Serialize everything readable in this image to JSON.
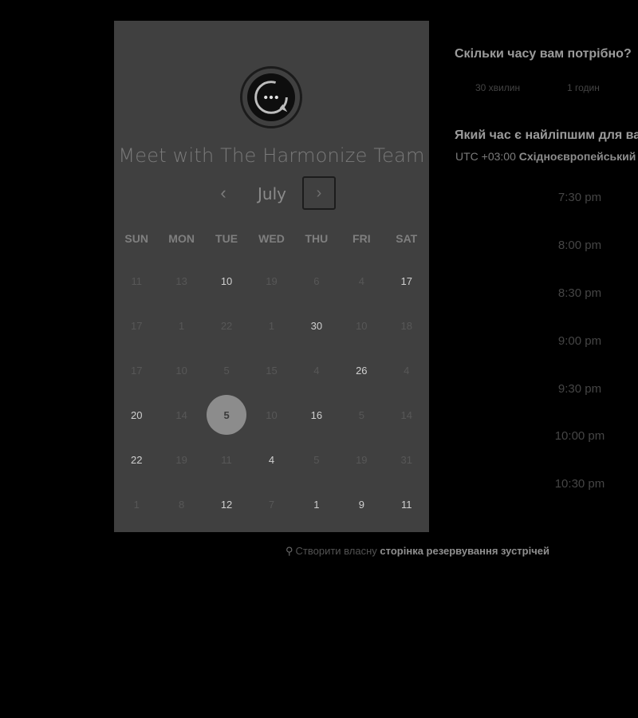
{
  "calendar": {
    "title": "Meet with The Harmonize Team",
    "month": "July",
    "prev_icon": "‹",
    "next_icon": "›",
    "weekdays": [
      "SUN",
      "MON",
      "TUE",
      "WED",
      "THU",
      "FRI",
      "SAT"
    ],
    "weeks": [
      [
        {
          "d": "11",
          "a": false
        },
        {
          "d": "13",
          "a": false
        },
        {
          "d": "10",
          "a": true
        },
        {
          "d": "19",
          "a": false
        },
        {
          "d": "6",
          "a": false
        },
        {
          "d": "4",
          "a": false
        },
        {
          "d": "17",
          "a": true
        }
      ],
      [
        {
          "d": "17",
          "a": false
        },
        {
          "d": "1",
          "a": false
        },
        {
          "d": "22",
          "a": false
        },
        {
          "d": "1",
          "a": false
        },
        {
          "d": "30",
          "a": true
        },
        {
          "d": "10",
          "a": false
        },
        {
          "d": "18",
          "a": false
        }
      ],
      [
        {
          "d": "17",
          "a": false
        },
        {
          "d": "10",
          "a": false
        },
        {
          "d": "5",
          "a": false
        },
        {
          "d": "15",
          "a": false
        },
        {
          "d": "4",
          "a": false
        },
        {
          "d": "26",
          "a": true
        },
        {
          "d": "4",
          "a": false
        }
      ],
      [
        {
          "d": "20",
          "a": true
        },
        {
          "d": "14",
          "a": false
        },
        {
          "d": "5",
          "a": true,
          "selected": true
        },
        {
          "d": "10",
          "a": false
        },
        {
          "d": "16",
          "a": true
        },
        {
          "d": "5",
          "a": false
        },
        {
          "d": "14",
          "a": false
        }
      ],
      [
        {
          "d": "22",
          "a": true
        },
        {
          "d": "19",
          "a": false
        },
        {
          "d": "11",
          "a": false
        },
        {
          "d": "4",
          "a": true
        },
        {
          "d": "5",
          "a": false
        },
        {
          "d": "19",
          "a": false
        },
        {
          "d": "31",
          "a": false
        }
      ],
      [
        {
          "d": "1",
          "a": false
        },
        {
          "d": "8",
          "a": false
        },
        {
          "d": "12",
          "a": true
        },
        {
          "d": "7",
          "a": false
        },
        {
          "d": "1",
          "a": true
        },
        {
          "d": "9",
          "a": true
        },
        {
          "d": "11",
          "a": true
        }
      ]
    ]
  },
  "duration": {
    "question": "Скільки часу вам потрібно?",
    "options": [
      "30 хвилин",
      "1 годин"
    ]
  },
  "time": {
    "question": "Який час є найліпшим для вас?",
    "timezone_prefix": "UTC +03:00",
    "timezone_name": "Східноєвропейський час",
    "slots": [
      "7:30 pm",
      "8:00 pm",
      "8:30 pm",
      "9:00 pm",
      "9:30 pm",
      "10:00 pm",
      "10:30 pm"
    ]
  },
  "footer": {
    "icon": "sprocket-icon",
    "prefix": "Створити власну",
    "link": "сторінка резервування зустрічей"
  }
}
